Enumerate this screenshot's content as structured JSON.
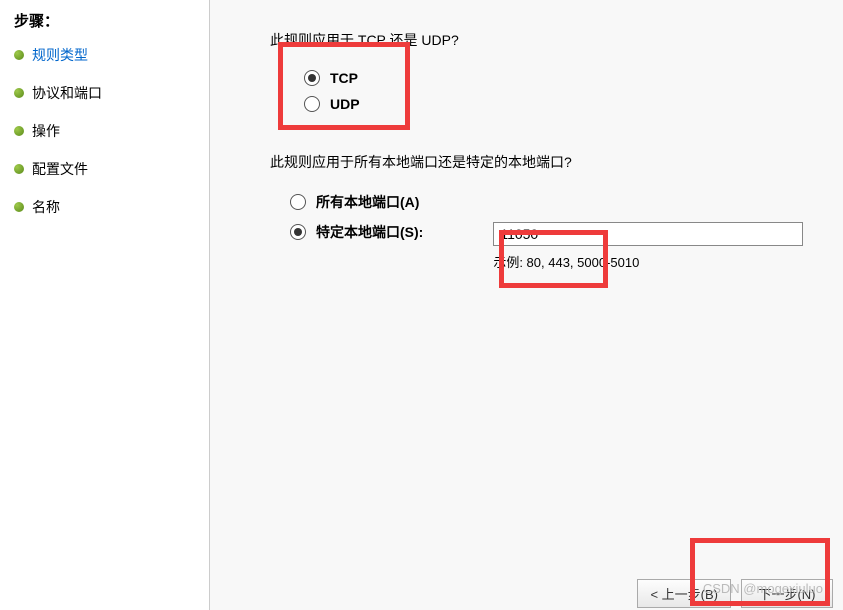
{
  "sidebar": {
    "title": "步骤：",
    "items": [
      {
        "label": "规则类型",
        "active": true
      },
      {
        "label": "协议和端口",
        "active": false
      },
      {
        "label": "操作",
        "active": false
      },
      {
        "label": "配置文件",
        "active": false
      },
      {
        "label": "名称",
        "active": false
      }
    ]
  },
  "main": {
    "question1": "此规则应用于 TCP 还是 UDP?",
    "protocol": {
      "tcp_label": "TCP",
      "udp_label": "UDP",
      "selected": "tcp"
    },
    "question2": "此规则应用于所有本地端口还是特定的本地端口?",
    "port_scope": {
      "all_label": "所有本地端口(A)",
      "specific_label": "特定本地端口(S):",
      "selected": "specific",
      "value": "11050",
      "example": "示例: 80, 443, 5000-5010"
    }
  },
  "buttons": {
    "back": "< 上一步(B)",
    "next": "下一步(N)"
  },
  "watermark": "CSDN @mogexiuluo"
}
